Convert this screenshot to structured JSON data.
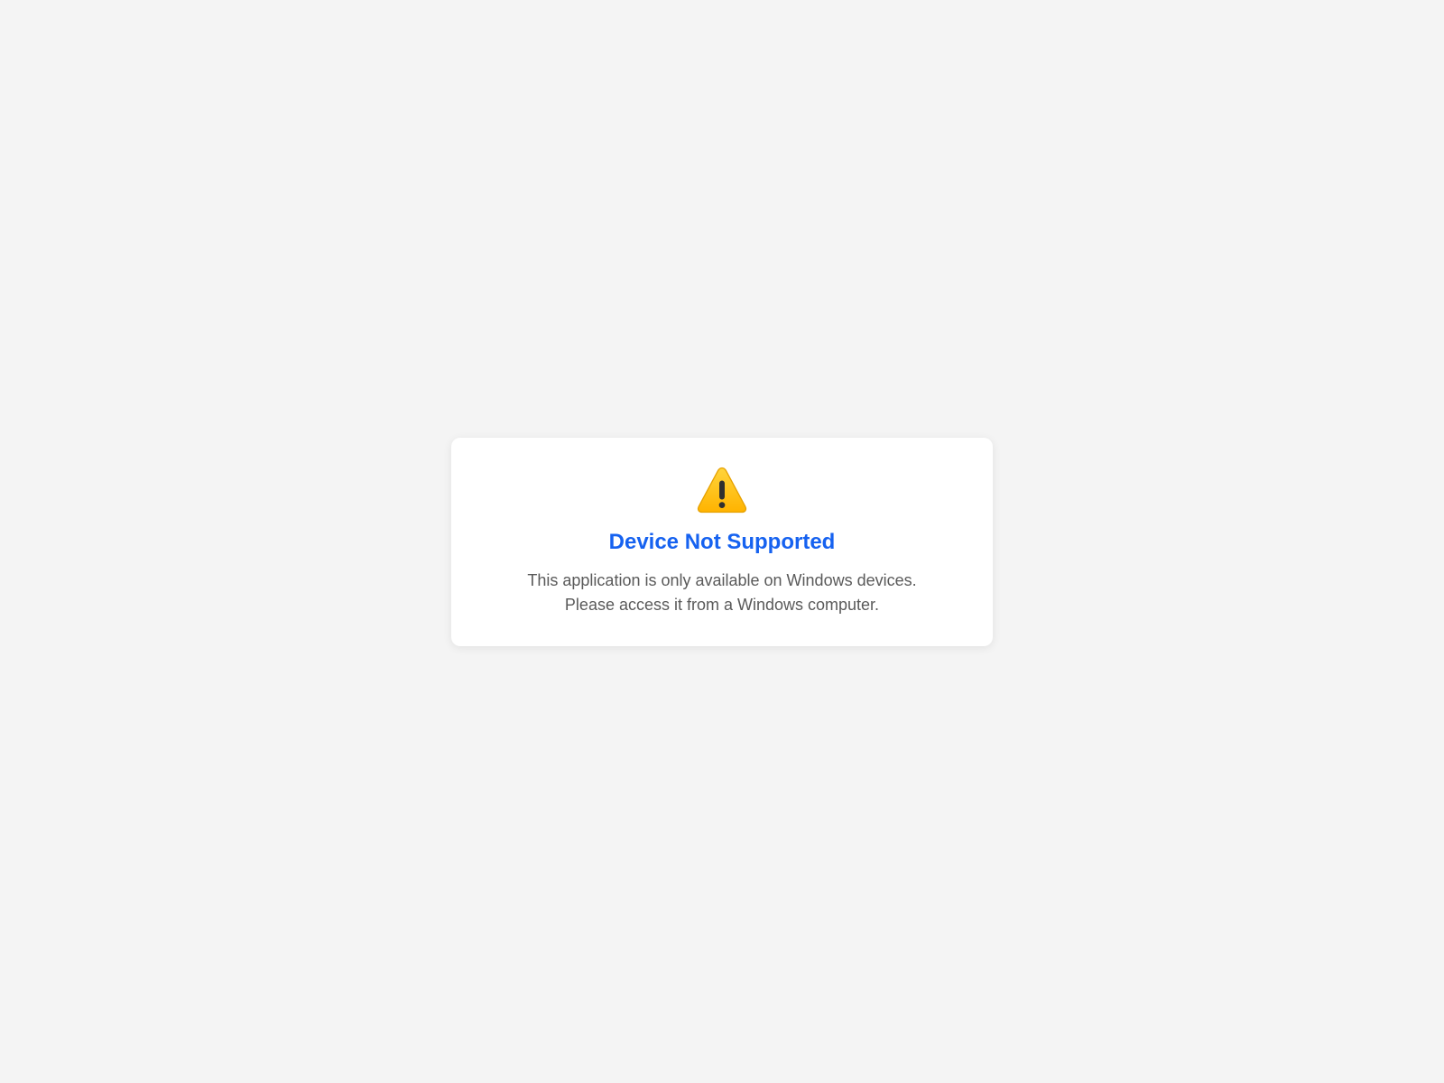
{
  "dialog": {
    "icon": "warning-icon",
    "title": "Device Not Supported",
    "message_line1": "This application is only available on Windows devices.",
    "message_line2": "Please access it from a Windows computer."
  },
  "colors": {
    "background": "#f4f4f4",
    "card": "#ffffff",
    "title": "#1662f0",
    "text": "#5a5a5a",
    "warning": "#ffc107"
  }
}
